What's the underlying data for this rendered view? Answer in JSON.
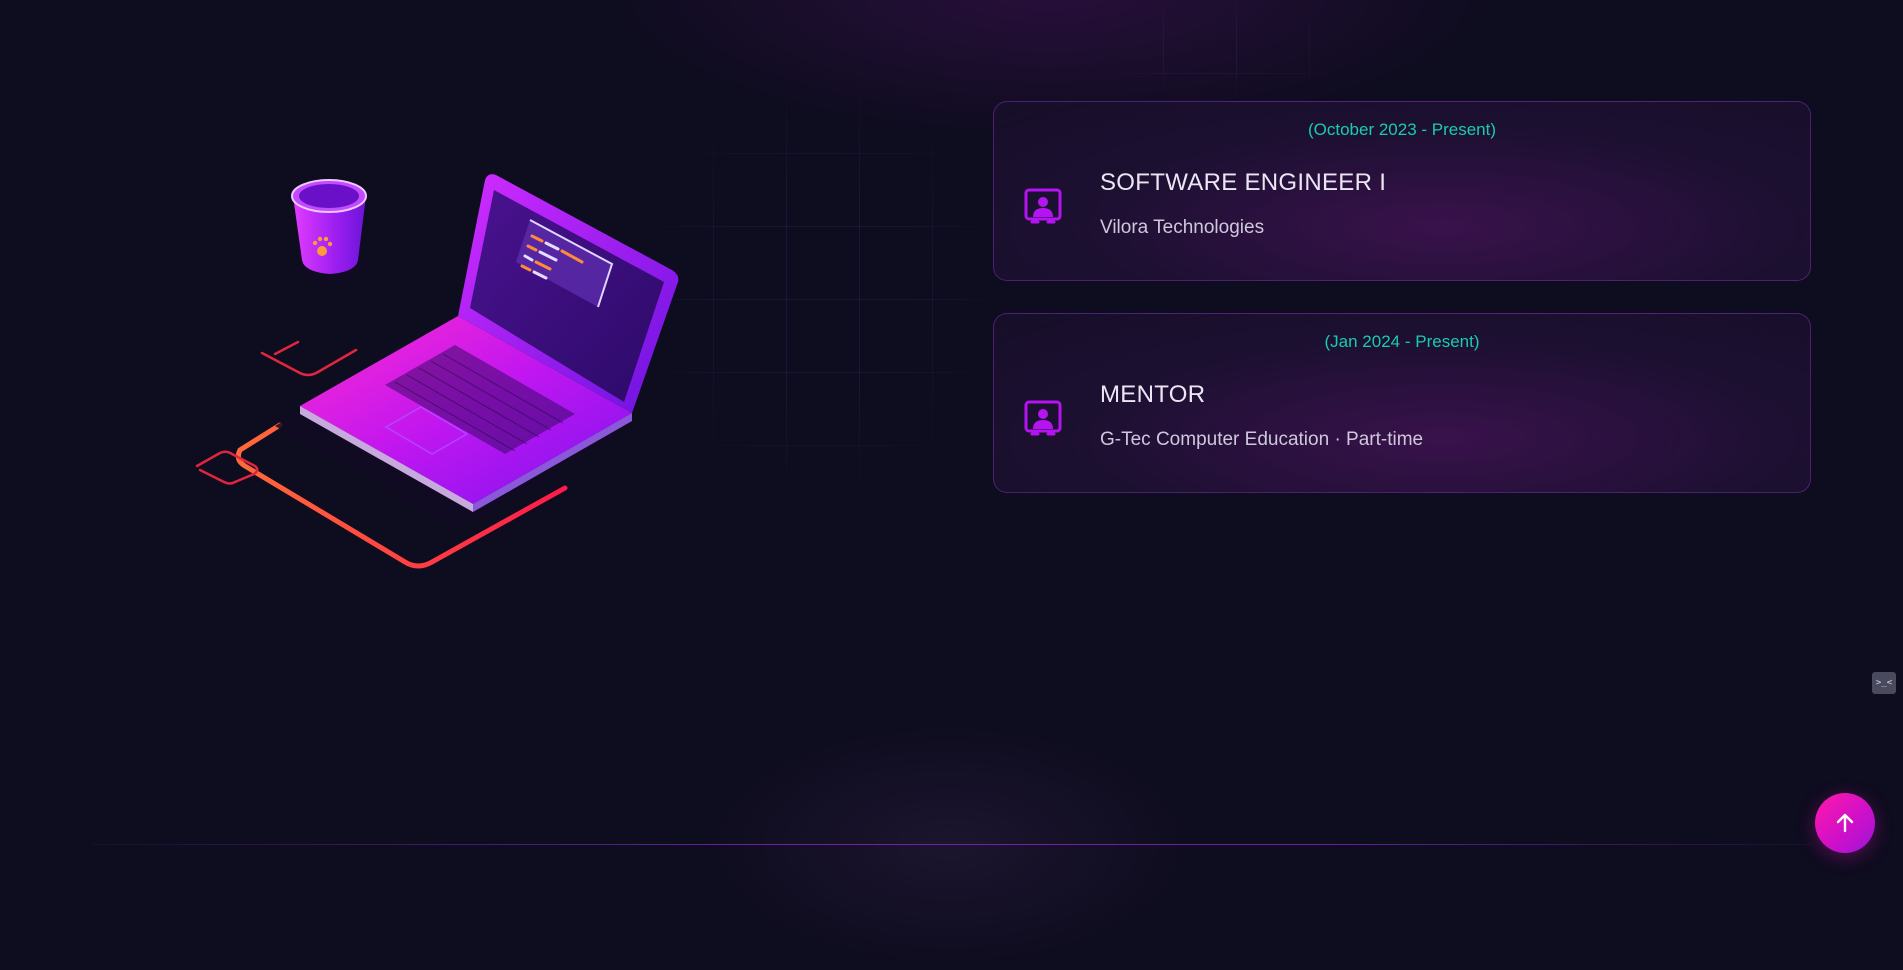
{
  "experience": [
    {
      "date": "(October 2023 - Present)",
      "title": "SOFTWARE ENGINEER I",
      "company": "Vilora Technologies"
    },
    {
      "date": "(Jan 2024 - Present)",
      "title": "MENTOR",
      "company": "G-Tec Computer Education · Part-time"
    }
  ],
  "widget": {
    "glyph": ">_<",
    "icon": "bot-widget-icon"
  },
  "back_to_top": {
    "icon": "arrow-up-icon"
  },
  "colors": {
    "background": "#0e0c1f",
    "date_accent": "#19cbb0",
    "icon_accent": "#b414f0",
    "button_gradient_start": "#ff1aa8",
    "button_gradient_end": "#9b16d8"
  }
}
